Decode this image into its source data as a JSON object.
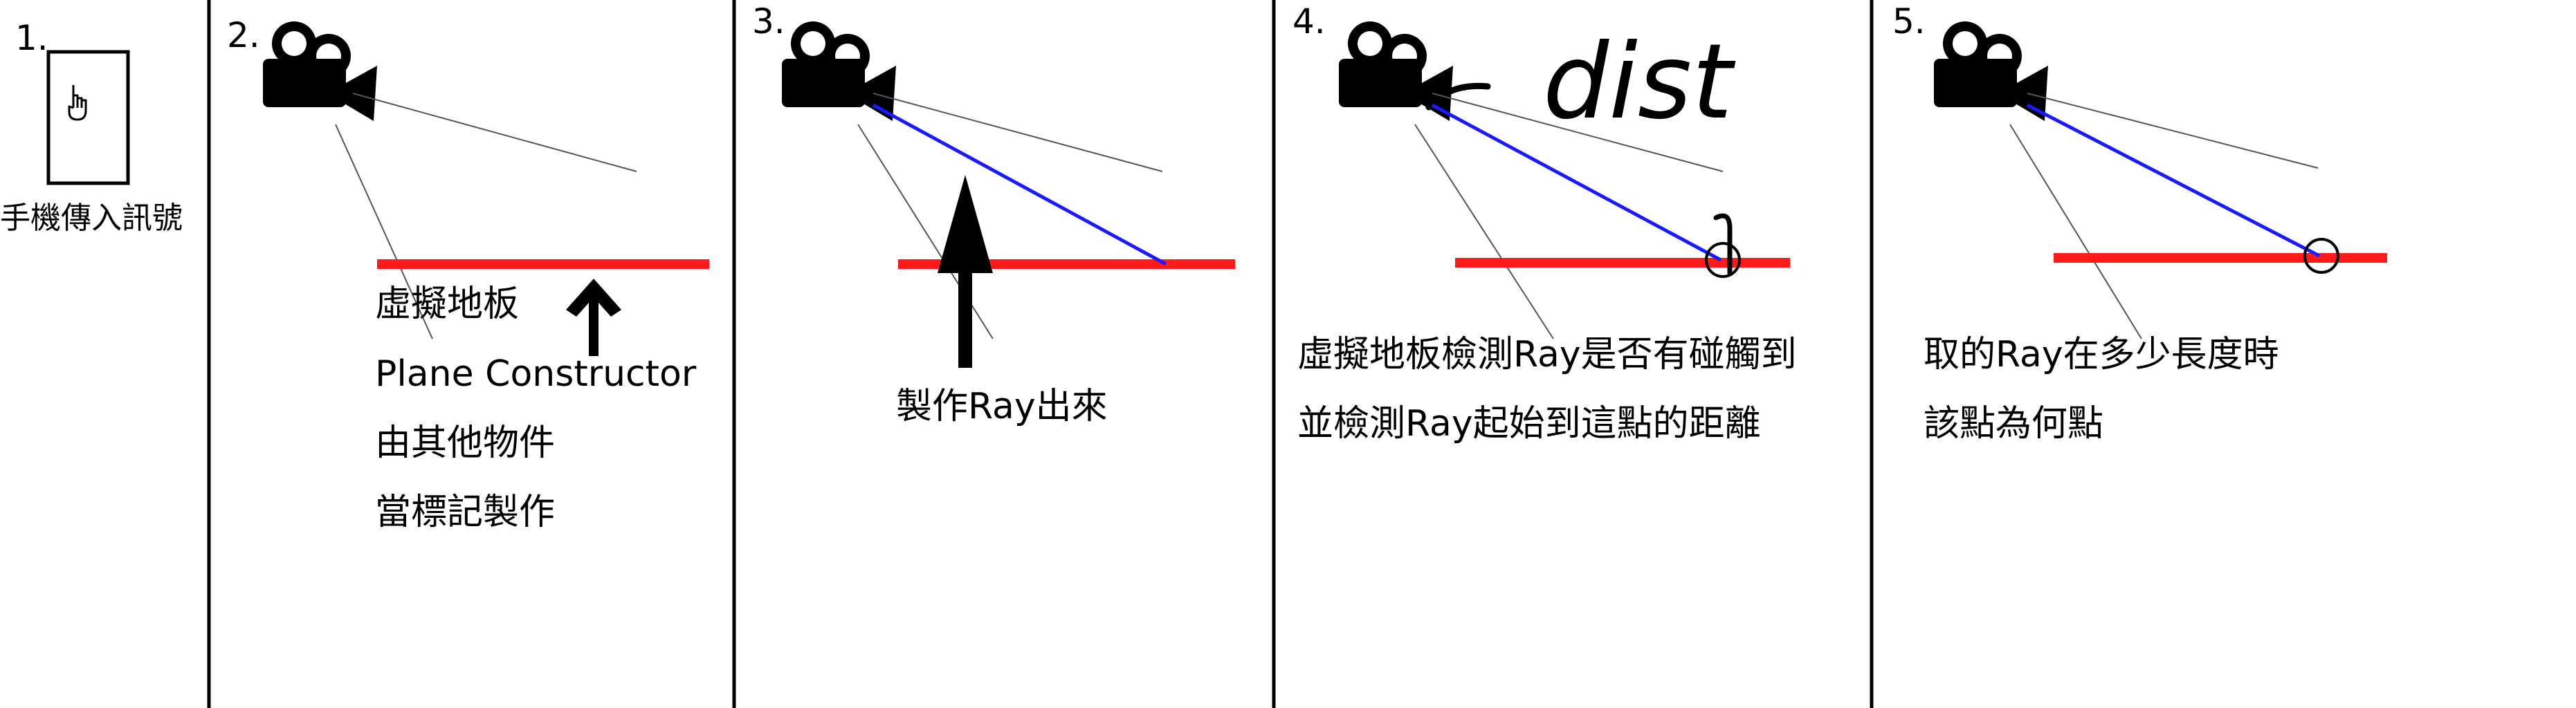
{
  "colors": {
    "floor": "#ff1a1a",
    "ray": "#1a1aff",
    "line": "#000000"
  },
  "panels": [
    {
      "number": "1.",
      "icon": "hand-pointer-icon",
      "caption": [
        "手機傳入訊號"
      ]
    },
    {
      "number": "2.",
      "icon": "camera-icon",
      "caption": [
        "虛擬地板",
        "Plane Constructor",
        "由其他物件",
        "當標記製作"
      ]
    },
    {
      "number": "3.",
      "icon": "camera-icon",
      "caption": [
        "製作Ray出來"
      ]
    },
    {
      "number": "4.",
      "icon": "camera-icon",
      "annotation": "dist",
      "caption": [
        "虛擬地板檢測Ray是否有碰觸到",
        "並檢測Ray起始到這點的距離"
      ]
    },
    {
      "number": "5.",
      "icon": "camera-icon",
      "caption": [
        "取的Ray在多少長度時",
        "該點為何點"
      ]
    }
  ]
}
